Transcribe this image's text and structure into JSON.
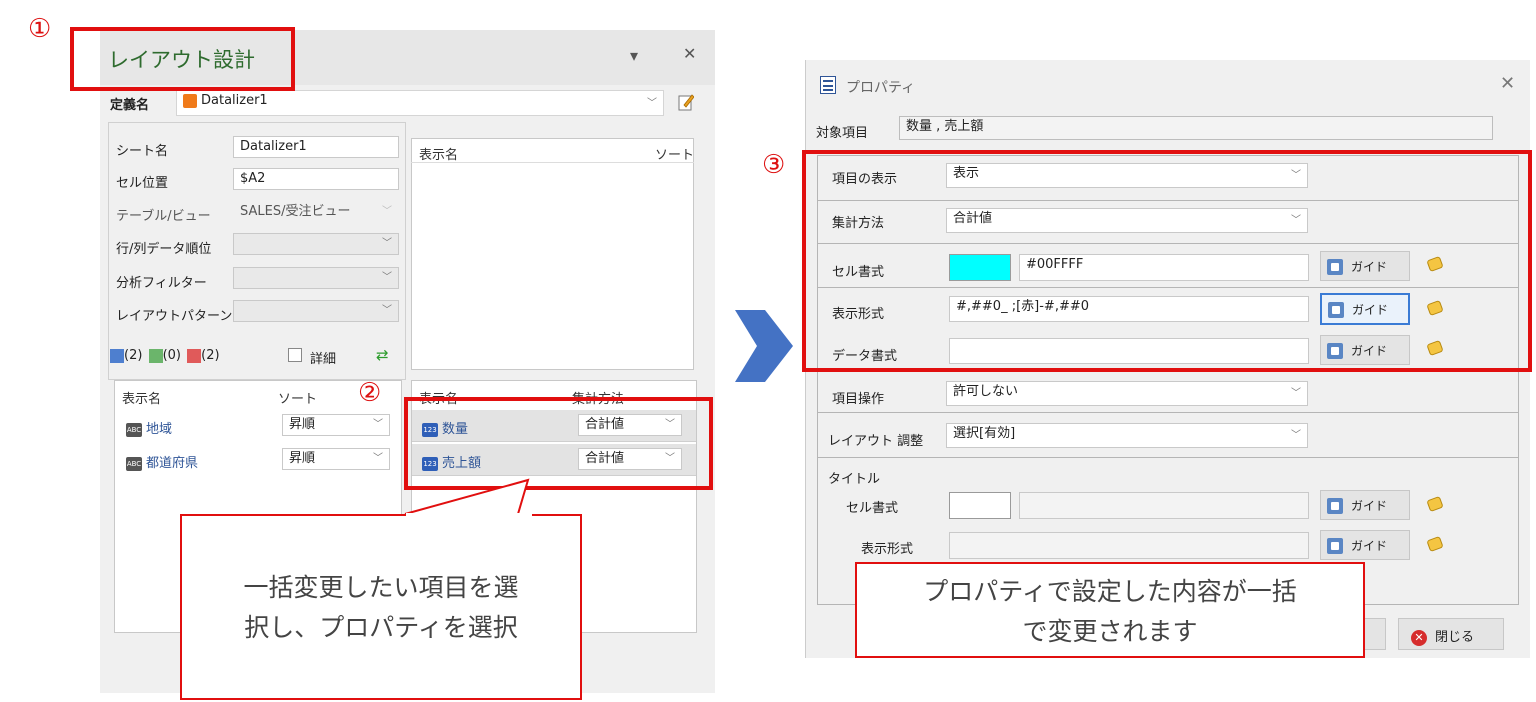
{
  "markers": {
    "one": "①",
    "two": "②",
    "three": "③"
  },
  "layout_panel": {
    "title": "レイアウト設計",
    "menu_btn": "▾",
    "close_btn": "✕",
    "def_label": "定義名",
    "def_value": "Datalizer1",
    "fields": [
      {
        "label": "シート名",
        "value": "Datalizer1"
      },
      {
        "label": "セル位置",
        "value": "$A2"
      },
      {
        "label": "テーブル/ビュー",
        "value": "SALES/受注ビュー"
      },
      {
        "label": "行/列データ順位",
        "value": ""
      },
      {
        "label": "分析フィルター",
        "value": ""
      },
      {
        "label": "レイアウトパターン",
        "value": ""
      }
    ],
    "display_list": {
      "col_name": "表示名",
      "col_sort": "ソート"
    },
    "counts": {
      "rows": "(2)",
      "cols": "(0)",
      "values": "(2)"
    },
    "detail_label": "詳細",
    "row_list": {
      "col_name": "表示名",
      "col_sort": "ソート",
      "items": [
        {
          "tag": "ABC",
          "name": "地域",
          "sort": "昇順"
        },
        {
          "tag": "ABC",
          "name": "都道府県",
          "sort": "昇順"
        }
      ]
    },
    "value_list": {
      "col_name": "表示名",
      "col_agg": "集計方法",
      "items": [
        {
          "tag": "123",
          "name": "数量",
          "agg": "合計値"
        },
        {
          "tag": "123",
          "name": "売上額",
          "agg": "合計値"
        }
      ]
    }
  },
  "callout_left": {
    "line1": "一括変更したい項目を選",
    "line2": "択し、プロパティを選択"
  },
  "dialog": {
    "title": "プロパティ",
    "close_btn": "✕",
    "target_label": "対象項目",
    "target_value": "数量 , 売上額",
    "rows": {
      "display": {
        "label": "項目の表示",
        "value": "表示"
      },
      "agg": {
        "label": "集計方法",
        "value": "合計値"
      },
      "cell_format": {
        "label": "セル書式",
        "color": "#00FFFF",
        "value": "#00FFFF"
      },
      "display_format": {
        "label": "表示形式",
        "value": "#,##0_ ;[赤]-#,##0"
      },
      "data_format": {
        "label": "データ書式",
        "value": ""
      },
      "operation": {
        "label": "項目操作",
        "value": "許可しない"
      },
      "layout_adjust": {
        "label": "レイアウト 調整",
        "value": "選択[有効]"
      }
    },
    "title_group": {
      "label": "タイトル",
      "cell_format_label": "セル書式",
      "display_format_label": "表示形式"
    },
    "guide_label": "ガイド",
    "close_label": "閉じる"
  },
  "callout_right": {
    "line1": "プロパティで設定した内容が一括",
    "line2": "で変更されます"
  },
  "colors": {
    "highlight": "#e10f0f",
    "arrow": "#4472c4",
    "cell_color": "#00FFFF"
  }
}
